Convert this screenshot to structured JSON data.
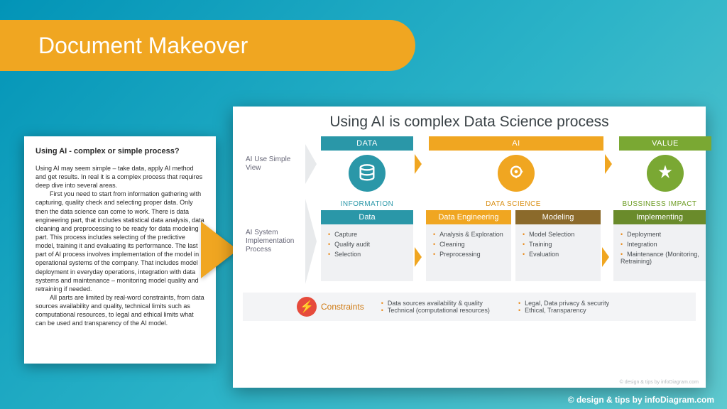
{
  "header": {
    "title": "Document Makeover"
  },
  "doc": {
    "title": "Using AI - complex or simple process?",
    "p1": "Using AI may seem simple – take data, apply AI method and get results. In real it is a complex process that requires deep dive into several areas.",
    "p2": "First you need to start from information gathering with capturing, quality check and selecting proper data. Only then the data science can come to work. There is data engineering part, that includes statistical data analysis, data cleaning and preprocessing to be ready for data modeling part. This process includes selecting of the predictive model, training it and evaluating its performance. The last part of AI process involves implementation of the model in operational systems of the company. That includes model deployment in everyday operations, integration with data systems and maintenance – monitoring model quality and retraining if needed.",
    "p3": "All parts are limited by real-word constraints, from data sources availability and quality, technical limits such as computational resources, to legal and ethical limits what can be used and transparency of the AI model."
  },
  "diagram": {
    "title": "Using AI is complex Data Science process",
    "row1_label": "AI Use Simple View",
    "row2_label": "AI System Implementation Process",
    "cols_simple": {
      "data": "DATA",
      "ai": "AI",
      "value": "VALUE"
    },
    "sections": {
      "info": "INFORMATION",
      "ds": "DATA SCIENCE",
      "impact": "BUSSINESS IMPACT"
    },
    "subcaps": {
      "data": "Data",
      "eng": "Data Engineering",
      "model": "Modeling",
      "impl": "Implementing"
    },
    "lists": {
      "data": [
        "Capture",
        "Quality audit",
        "Selection"
      ],
      "eng": [
        "Analysis & Exploration",
        "Cleaning",
        "Preprocessing"
      ],
      "model": [
        "Model Selection",
        "Training",
        "Evaluation"
      ],
      "impl": [
        "Deployment",
        "Integration",
        "Maintenance (Monitoring, Retraining)"
      ]
    },
    "constraints": {
      "label": "Constraints",
      "left": [
        "Data sources availability & quality",
        "Technical (computational resources)"
      ],
      "right": [
        "Legal, Data privacy & security",
        "Ethical, Transparency"
      ]
    },
    "credit": "© design & tips by infoDiagram.com"
  },
  "footer": "© design & tips by infoDiagram.com"
}
